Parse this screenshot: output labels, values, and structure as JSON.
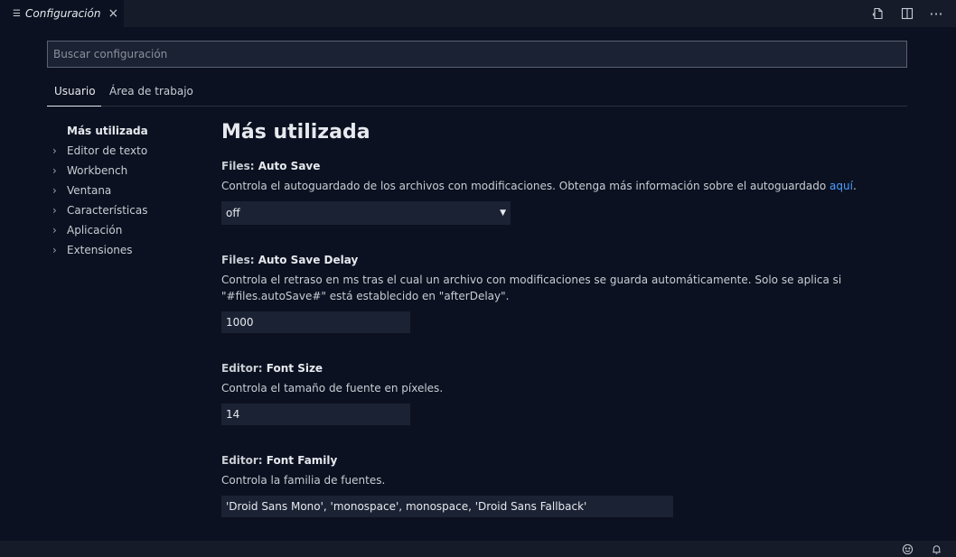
{
  "tab": {
    "title": "Configuración"
  },
  "search": {
    "placeholder": "Buscar configuración"
  },
  "scope_tabs": [
    "Usuario",
    "Área de trabajo"
  ],
  "tree": [
    {
      "label": "Más utilizada",
      "expandable": false
    },
    {
      "label": "Editor de texto",
      "expandable": true
    },
    {
      "label": "Workbench",
      "expandable": true
    },
    {
      "label": "Ventana",
      "expandable": true
    },
    {
      "label": "Características",
      "expandable": true
    },
    {
      "label": "Aplicación",
      "expandable": true
    },
    {
      "label": "Extensiones",
      "expandable": true
    }
  ],
  "section_title": "Más utilizada",
  "settings": [
    {
      "category": "Files: ",
      "key": "Auto Save",
      "description": "Controla el autoguardado de los archivos con modificaciones. Obtenga más información sobre el autoguardado ",
      "link": "aquí",
      "trail": ".",
      "value": "off"
    },
    {
      "category": "Files: ",
      "key": "Auto Save Delay",
      "description_line1": "Controla el retraso en ms tras el cual un archivo con modificaciones se guarda automáticamente. Solo se aplica si",
      "description_line2": "\"#files.autoSave#\" está establecido en \"afterDelay\".",
      "value": "1000"
    },
    {
      "category": "Editor: ",
      "key": "Font Size",
      "description": "Controla el tamaño de fuente en píxeles.",
      "value": "14"
    },
    {
      "category": "Editor: ",
      "key": "Font Family",
      "description": "Controla la familia de fuentes.",
      "value": "'Droid Sans Mono', 'monospace', monospace, 'Droid Sans Fallback'"
    }
  ],
  "icons": {
    "tab_menu": "list-icon",
    "close": "close-icon",
    "open_json": "open-settings-json-icon",
    "split": "split-editor-icon",
    "more": "more-actions-icon",
    "select_arrow": "chevron-down-icon",
    "feedback": "smiley-icon",
    "notifications": "bell-icon"
  }
}
